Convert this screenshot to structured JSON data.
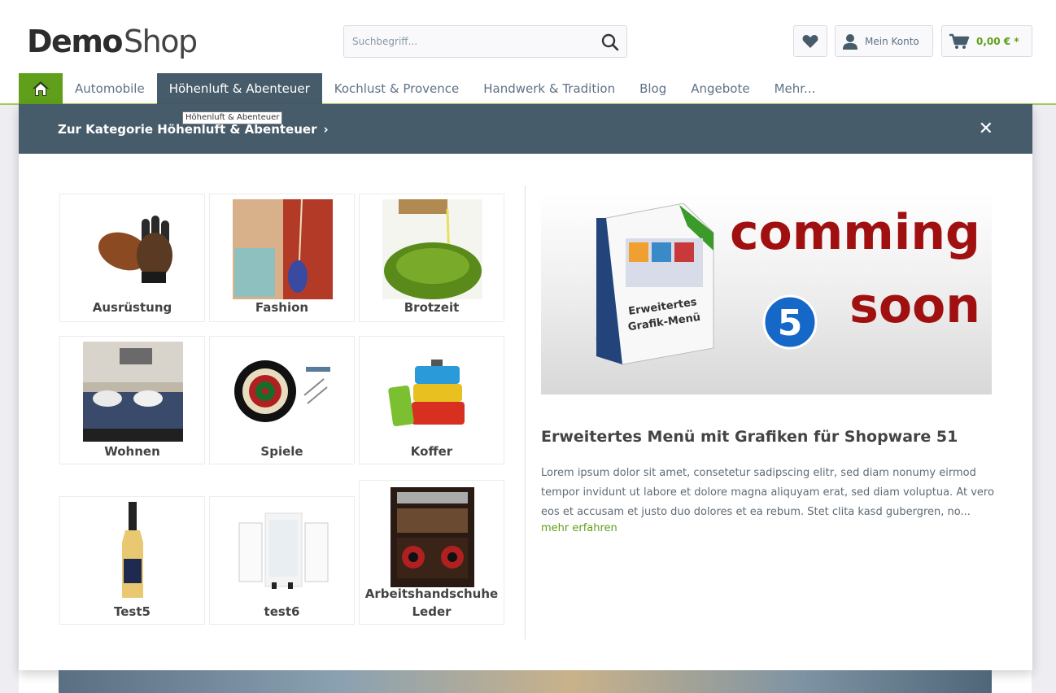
{
  "header": {
    "logo_bold": "Demo",
    "logo_light": "Shop",
    "search_placeholder": "Suchbegriff...",
    "account_label": "Mein Konto",
    "cart_label": "0,00 € *"
  },
  "nav": {
    "items": [
      {
        "label": "Automobile"
      },
      {
        "label": "Höhenluft & Abenteuer"
      },
      {
        "label": "Kochlust & Provence"
      },
      {
        "label": "Handwerk & Tradition"
      },
      {
        "label": "Blog"
      },
      {
        "label": "Angebote"
      },
      {
        "label": "Mehr..."
      }
    ],
    "tooltip": "Höhenluft & Abenteuer"
  },
  "menu": {
    "category_link": "Zur Kategorie Höhenluft & Abenteuer",
    "tiles": [
      {
        "label": "Ausrüstung"
      },
      {
        "label": "Fashion"
      },
      {
        "label": "Brotzeit"
      },
      {
        "label": "Wohnen"
      },
      {
        "label": "Spiele"
      },
      {
        "label": "Koffer"
      },
      {
        "label": "Test5"
      },
      {
        "label": "test6"
      },
      {
        "label_line1": "Arbeitshandschuhe",
        "label_line2": "Leder"
      }
    ],
    "teaser": {
      "banner_word1": "comming",
      "banner_word2": "soon",
      "banner_number": "5",
      "box_text_line1": "Erweitertes",
      "box_text_line2": "Grafik-Menü",
      "title": "Erweitertes Menü mit Grafiken für Shopware 51",
      "text": "Lorem ipsum dolor sit amet, consetetur sadipscing elitr, sed diam nonumy eirmod tempor invidunt ut labore et dolore magna aliquyam erat, sed diam voluptua. At vero eos et accusam et justo duo dolores et ea rebum. Stet clita kasd gubergren, no...",
      "more_link": "mehr erfahren"
    }
  },
  "colors": {
    "brand_green": "#5f9f1a",
    "nav_active": "#475c6a",
    "banner_red": "#a01010"
  }
}
